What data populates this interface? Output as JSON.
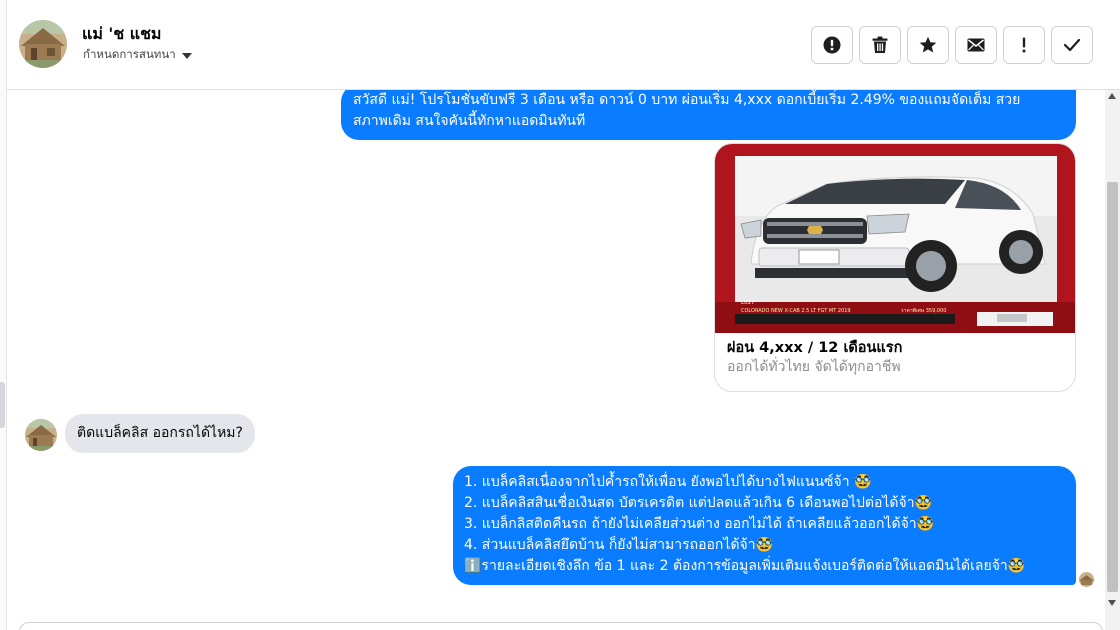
{
  "header": {
    "contact_name": "แม่ 'ช แชม",
    "conversation_menu_label": "กำหนดการสนทนา"
  },
  "toolbar": {
    "buttons": [
      {
        "name": "report-button",
        "icon": "alert-circle-icon",
        "glyph": "!"
      },
      {
        "name": "delete-button",
        "icon": "trash-icon"
      },
      {
        "name": "star-button",
        "icon": "star-icon"
      },
      {
        "name": "mark-unread-button",
        "icon": "envelope-icon"
      },
      {
        "name": "spam-button",
        "icon": "exclamation-icon",
        "glyph": "!"
      },
      {
        "name": "mark-done-button",
        "icon": "checkmark-icon"
      }
    ]
  },
  "messages": {
    "outgoing_promo": {
      "line1": "สวัสดี แม่! โปรโมชั่นขับฟรี 3 เดือน หรือ ดาวน์ 0 บาท ผ่อนเริ่ม 4,xxx ดอกเบี้ยเริ่ม 2.49% ของแถมจัดเต็ม สวย",
      "line2": "สภาพเดิม สนใจคันนี้ทักหาแอดมินทันที"
    },
    "card": {
      "title": "ผ่อน 4,xxx / 12 เดือนแรก",
      "subtitle": "ออกได้ทั่วไทย จัดได้ทุกอาชีพ",
      "image_caption": "COLORADO NEW X-CAB 2.5 LT FGT MT 2019",
      "image_price": "ราคาพิเศษ 359,000",
      "image_code": "L027"
    },
    "incoming": {
      "text": "ติดแบล็คลิส ออกรถได้ไหม?"
    },
    "outgoing_answer": {
      "lines": [
        "1. แบล็คลิสเนื่องจากไปค้ำรถให้เพื่อน ยังพอไปได้บางไฟแนนซ์จ้า 🥸",
        "2. แบล็คลิสสินเชื่อเงินสด บัตรเครดิต แต่ปลดแล้วเกิน 6 เดือนพอไปต่อได้จ้า🥸",
        "3. แบล็กลิสติดคืนรถ ถ้ายังไม่เคลียส่วนต่าง ออกไม่ได้ ถ้าเคลียแล้วออกได้จ้า🥸",
        "4. ส่วนแบล็คลิสยึดบ้าน ก็ยังไม่สามารถออกได้จ้า🥸",
        "ℹ️รายละเอียดเชิงลึก ข้อ 1 และ 2 ต้องการข้อมูลเพิ่มเติมแจ้งเบอร์ติดต่อให้แอดมินได้เลยจ้า🥸"
      ]
    }
  },
  "colors": {
    "outgoing_bubble": "#0a7cff",
    "incoming_bubble": "#e4e6eb",
    "card_subtitle": "#8a8d91"
  }
}
